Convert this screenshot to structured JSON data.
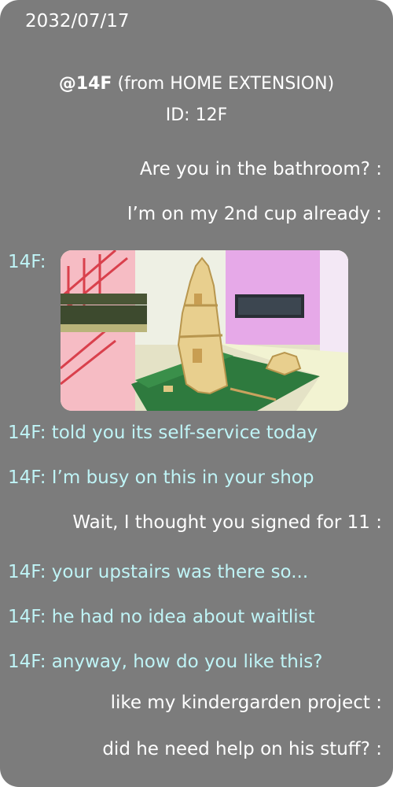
{
  "header": {
    "date": "2032/07/17",
    "handle": "@14F",
    "source": " (from HOME EXTENSION)",
    "id_line": "ID: 12F"
  },
  "sender_prefix": "14F:",
  "messages": [
    {
      "dir": "out",
      "text": "Are you in the bathroom? :"
    },
    {
      "dir": "out",
      "text": "I’m on my 2nd cup already :"
    },
    {
      "dir": "in",
      "text": "14F: told you its self-service today"
    },
    {
      "dir": "in",
      "text": "14F: I’m busy on this in your shop"
    },
    {
      "dir": "out",
      "text": "Wait, I thought you signed for 11 :"
    },
    {
      "dir": "in",
      "text": "14F: your upstairs was there so..."
    },
    {
      "dir": "in",
      "text": "14F: he had no idea about waitlist"
    },
    {
      "dir": "in",
      "text": "14F: anyway, how do you like this?"
    },
    {
      "dir": "out",
      "text": "like my kindergarden project  :"
    },
    {
      "dir": "out",
      "text": "did he need help on his stuff?  :"
    }
  ],
  "colors": {
    "panel_bg": "#7c7c7c",
    "outgoing_text": "#ffffff",
    "incoming_text": "#bff4f6"
  }
}
